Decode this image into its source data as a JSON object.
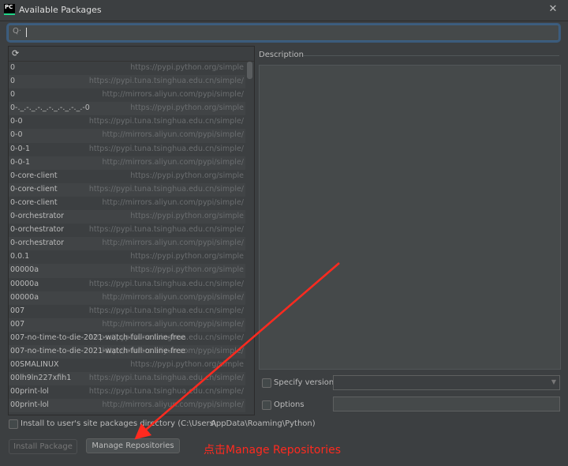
{
  "window": {
    "title": "Available Packages",
    "app_icon_label": "PC",
    "close_glyph": "✕"
  },
  "search": {
    "icon": "Q·",
    "value": "",
    "placeholder": ""
  },
  "list": {
    "refresh_icon": "⟳",
    "packages": [
      {
        "name": "0",
        "repo": "https://pypi.python.org/simple"
      },
      {
        "name": "0",
        "repo": "https://pypi.tuna.tsinghua.edu.cn/simple/"
      },
      {
        "name": "0",
        "repo": "http://mirrors.aliyun.com/pypi/simple/"
      },
      {
        "name": "0-._.-._.-._.-._.-._.-._.-0",
        "repo": "https://pypi.python.org/simple"
      },
      {
        "name": "0-0",
        "repo": "https://pypi.tuna.tsinghua.edu.cn/simple/"
      },
      {
        "name": "0-0",
        "repo": "http://mirrors.aliyun.com/pypi/simple/"
      },
      {
        "name": "0-0-1",
        "repo": "https://pypi.tuna.tsinghua.edu.cn/simple/"
      },
      {
        "name": "0-0-1",
        "repo": "http://mirrors.aliyun.com/pypi/simple/"
      },
      {
        "name": "0-core-client",
        "repo": "https://pypi.python.org/simple"
      },
      {
        "name": "0-core-client",
        "repo": "https://pypi.tuna.tsinghua.edu.cn/simple/"
      },
      {
        "name": "0-core-client",
        "repo": "http://mirrors.aliyun.com/pypi/simple/"
      },
      {
        "name": "0-orchestrator",
        "repo": "https://pypi.python.org/simple"
      },
      {
        "name": "0-orchestrator",
        "repo": "https://pypi.tuna.tsinghua.edu.cn/simple/"
      },
      {
        "name": "0-orchestrator",
        "repo": "http://mirrors.aliyun.com/pypi/simple/"
      },
      {
        "name": "0.0.1",
        "repo": "https://pypi.python.org/simple"
      },
      {
        "name": "00000a",
        "repo": "https://pypi.python.org/simple"
      },
      {
        "name": "00000a",
        "repo": "https://pypi.tuna.tsinghua.edu.cn/simple/"
      },
      {
        "name": "00000a",
        "repo": "http://mirrors.aliyun.com/pypi/simple/"
      },
      {
        "name": "007",
        "repo": "https://pypi.tuna.tsinghua.edu.cn/simple/"
      },
      {
        "name": "007",
        "repo": "http://mirrors.aliyun.com/pypi/simple/"
      },
      {
        "name": "007-no-time-to-die-2021-watch-full-online-free",
        "repo": "https://pypi.tuna.tsinghua.edu.cn/simple/"
      },
      {
        "name": "007-no-time-to-die-2021-watch-full-online-free",
        "repo": "http://mirrors.aliyun.com/pypi/simple/"
      },
      {
        "name": "00SMALINUX",
        "repo": "https://pypi.python.org/simple"
      },
      {
        "name": "00lh9ln227xfih1",
        "repo": "https://pypi.tuna.tsinghua.edu.cn/simple/"
      },
      {
        "name": "00print-lol",
        "repo": "https://pypi.tuna.tsinghua.edu.cn/simple/"
      },
      {
        "name": "00print-lol",
        "repo": "http://mirrors.aliyun.com/pypi/simple/"
      }
    ]
  },
  "description": {
    "label": "Description",
    "content": ""
  },
  "specify_version": {
    "label": "Specify version",
    "checked": false,
    "selected": ""
  },
  "options": {
    "label": "Options",
    "checked": false,
    "value": ""
  },
  "install_user": {
    "label": "Install to user's site packages directory (C:\\Users\\",
    "suffix": "AppData\\Roaming\\Python)",
    "checked": false
  },
  "buttons": {
    "install": "Install Package",
    "manage": "Manage Repositories"
  },
  "annotation": {
    "text": "点击Manage Repositories",
    "color": "#ff2a1f"
  },
  "colors": {
    "background": "#3c3f41",
    "accent": "#3d6185",
    "annotation_red": "#ff2a1f"
  }
}
